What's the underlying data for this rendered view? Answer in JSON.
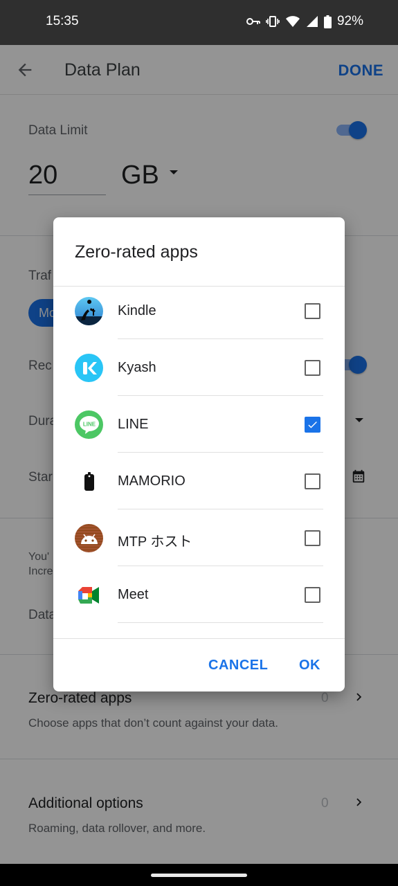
{
  "status": {
    "time": "15:35",
    "battery": "92%"
  },
  "appbar": {
    "title": "Data Plan",
    "done_label": "DONE"
  },
  "settings": {
    "data_limit_label": "Data Limit",
    "limit_value": "20",
    "limit_unit": "GB",
    "traffic_label_partial": "Traf",
    "chip_partial": "Mo",
    "recurring_label_partial": "Rec",
    "duration_label_partial": "Dura",
    "start_label_partial": "Star",
    "note_line1_partial": "You'",
    "note_line2_partial": "Incre",
    "data_label_partial": "Data",
    "zero_rated_title": "Zero-rated apps",
    "zero_rated_sub": "Choose apps that don’t count against your data.",
    "zero_rated_count": "0",
    "additional_title": "Additional options",
    "additional_sub": "Roaming, data rollover, and more.",
    "additional_count": "0"
  },
  "dialog": {
    "title": "Zero-rated apps",
    "apps": [
      {
        "name": "Kindle",
        "checked": false,
        "icon": "kindle-icon"
      },
      {
        "name": "Kyash",
        "checked": false,
        "icon": "kyash-icon"
      },
      {
        "name": "LINE",
        "checked": true,
        "icon": "line-icon"
      },
      {
        "name": "MAMORIO",
        "checked": false,
        "icon": "mamorio-icon"
      },
      {
        "name": "MTP ホスト",
        "checked": false,
        "icon": "android-icon"
      },
      {
        "name": "Meet",
        "checked": false,
        "icon": "meet-icon"
      }
    ],
    "cancel_label": "CANCEL",
    "ok_label": "OK"
  },
  "colors": {
    "accent": "#1a73e8",
    "status_bar": "#2f2f2f",
    "line_green": "#4cc764",
    "kyash_blue": "#29c5f6"
  }
}
